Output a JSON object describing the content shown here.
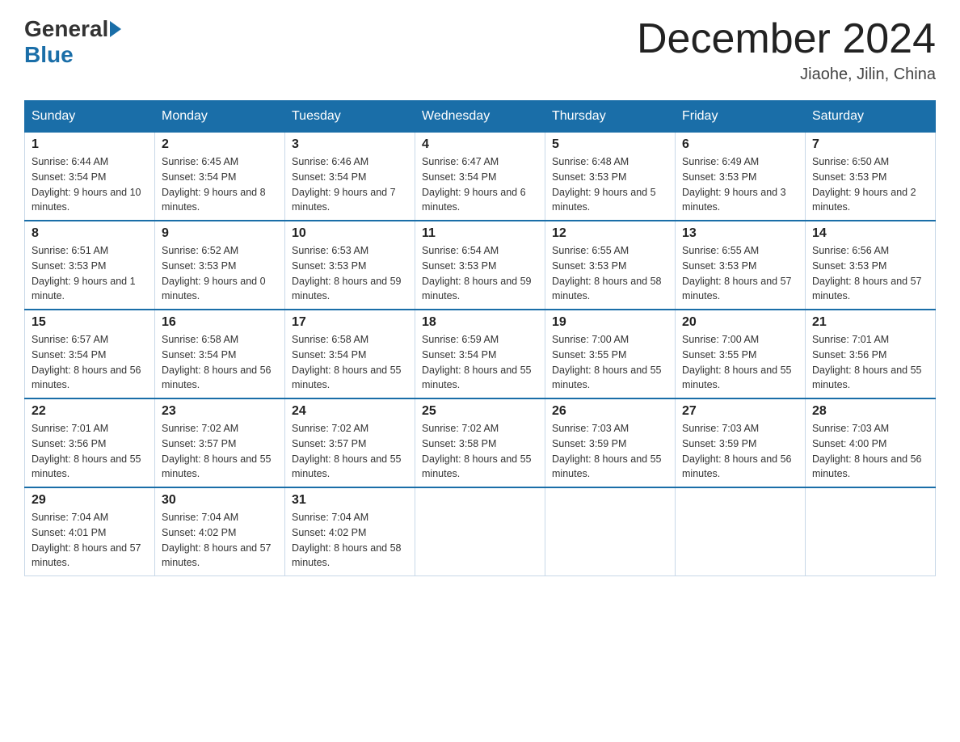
{
  "logo": {
    "general": "General",
    "blue": "Blue"
  },
  "title": "December 2024",
  "location": "Jiaohe, Jilin, China",
  "days_of_week": [
    "Sunday",
    "Monday",
    "Tuesday",
    "Wednesday",
    "Thursday",
    "Friday",
    "Saturday"
  ],
  "weeks": [
    [
      {
        "day": "1",
        "sunrise": "6:44 AM",
        "sunset": "3:54 PM",
        "daylight": "9 hours and 10 minutes."
      },
      {
        "day": "2",
        "sunrise": "6:45 AM",
        "sunset": "3:54 PM",
        "daylight": "9 hours and 8 minutes."
      },
      {
        "day": "3",
        "sunrise": "6:46 AM",
        "sunset": "3:54 PM",
        "daylight": "9 hours and 7 minutes."
      },
      {
        "day": "4",
        "sunrise": "6:47 AM",
        "sunset": "3:54 PM",
        "daylight": "9 hours and 6 minutes."
      },
      {
        "day": "5",
        "sunrise": "6:48 AM",
        "sunset": "3:53 PM",
        "daylight": "9 hours and 5 minutes."
      },
      {
        "day": "6",
        "sunrise": "6:49 AM",
        "sunset": "3:53 PM",
        "daylight": "9 hours and 3 minutes."
      },
      {
        "day": "7",
        "sunrise": "6:50 AM",
        "sunset": "3:53 PM",
        "daylight": "9 hours and 2 minutes."
      }
    ],
    [
      {
        "day": "8",
        "sunrise": "6:51 AM",
        "sunset": "3:53 PM",
        "daylight": "9 hours and 1 minute."
      },
      {
        "day": "9",
        "sunrise": "6:52 AM",
        "sunset": "3:53 PM",
        "daylight": "9 hours and 0 minutes."
      },
      {
        "day": "10",
        "sunrise": "6:53 AM",
        "sunset": "3:53 PM",
        "daylight": "8 hours and 59 minutes."
      },
      {
        "day": "11",
        "sunrise": "6:54 AM",
        "sunset": "3:53 PM",
        "daylight": "8 hours and 59 minutes."
      },
      {
        "day": "12",
        "sunrise": "6:55 AM",
        "sunset": "3:53 PM",
        "daylight": "8 hours and 58 minutes."
      },
      {
        "day": "13",
        "sunrise": "6:55 AM",
        "sunset": "3:53 PM",
        "daylight": "8 hours and 57 minutes."
      },
      {
        "day": "14",
        "sunrise": "6:56 AM",
        "sunset": "3:53 PM",
        "daylight": "8 hours and 57 minutes."
      }
    ],
    [
      {
        "day": "15",
        "sunrise": "6:57 AM",
        "sunset": "3:54 PM",
        "daylight": "8 hours and 56 minutes."
      },
      {
        "day": "16",
        "sunrise": "6:58 AM",
        "sunset": "3:54 PM",
        "daylight": "8 hours and 56 minutes."
      },
      {
        "day": "17",
        "sunrise": "6:58 AM",
        "sunset": "3:54 PM",
        "daylight": "8 hours and 55 minutes."
      },
      {
        "day": "18",
        "sunrise": "6:59 AM",
        "sunset": "3:54 PM",
        "daylight": "8 hours and 55 minutes."
      },
      {
        "day": "19",
        "sunrise": "7:00 AM",
        "sunset": "3:55 PM",
        "daylight": "8 hours and 55 minutes."
      },
      {
        "day": "20",
        "sunrise": "7:00 AM",
        "sunset": "3:55 PM",
        "daylight": "8 hours and 55 minutes."
      },
      {
        "day": "21",
        "sunrise": "7:01 AM",
        "sunset": "3:56 PM",
        "daylight": "8 hours and 55 minutes."
      }
    ],
    [
      {
        "day": "22",
        "sunrise": "7:01 AM",
        "sunset": "3:56 PM",
        "daylight": "8 hours and 55 minutes."
      },
      {
        "day": "23",
        "sunrise": "7:02 AM",
        "sunset": "3:57 PM",
        "daylight": "8 hours and 55 minutes."
      },
      {
        "day": "24",
        "sunrise": "7:02 AM",
        "sunset": "3:57 PM",
        "daylight": "8 hours and 55 minutes."
      },
      {
        "day": "25",
        "sunrise": "7:02 AM",
        "sunset": "3:58 PM",
        "daylight": "8 hours and 55 minutes."
      },
      {
        "day": "26",
        "sunrise": "7:03 AM",
        "sunset": "3:59 PM",
        "daylight": "8 hours and 55 minutes."
      },
      {
        "day": "27",
        "sunrise": "7:03 AM",
        "sunset": "3:59 PM",
        "daylight": "8 hours and 56 minutes."
      },
      {
        "day": "28",
        "sunrise": "7:03 AM",
        "sunset": "4:00 PM",
        "daylight": "8 hours and 56 minutes."
      }
    ],
    [
      {
        "day": "29",
        "sunrise": "7:04 AM",
        "sunset": "4:01 PM",
        "daylight": "8 hours and 57 minutes."
      },
      {
        "day": "30",
        "sunrise": "7:04 AM",
        "sunset": "4:02 PM",
        "daylight": "8 hours and 57 minutes."
      },
      {
        "day": "31",
        "sunrise": "7:04 AM",
        "sunset": "4:02 PM",
        "daylight": "8 hours and 58 minutes."
      },
      null,
      null,
      null,
      null
    ]
  ]
}
